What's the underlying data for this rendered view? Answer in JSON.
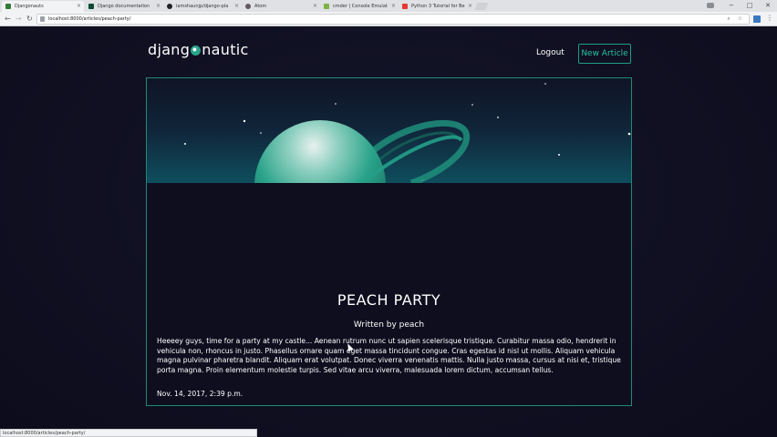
{
  "browser": {
    "tabs": [
      {
        "title": "Djangonauts",
        "favicon_color": "#2e7d32",
        "active": true
      },
      {
        "title": "Django documentation",
        "favicon_color": "#0c4b33",
        "active": false
      },
      {
        "title": "iamshaunjp/django-pla",
        "favicon_color": "#222222",
        "active": false
      },
      {
        "title": "Atom",
        "favicon_color": "#66595c",
        "active": false
      },
      {
        "title": "cmder | Console Emulat",
        "favicon_color": "#7cb342",
        "active": false
      },
      {
        "title": "Python 3 Tutorial for Be",
        "favicon_color": "#e53935",
        "active": false
      }
    ],
    "url": "localhost:8000/articles/peach-party/",
    "status_url": "localhost:8000/articles/peach-party/",
    "icons": {
      "back": "←",
      "forward": "→",
      "reload": "↻",
      "omnibox_right": "⌕ ☆",
      "menu": "⋮",
      "minimize": "−",
      "maximize": "□",
      "close": "✕",
      "tab_close": "×"
    }
  },
  "site": {
    "brand_left": "djang",
    "brand_right": "nautic",
    "logout": "Logout",
    "new_article": "New Article"
  },
  "article": {
    "title": "PEACH PARTY",
    "author": "Written by peach",
    "body": "Heeeey guys, time for a party at my castle... Aenean rutrum nunc ut sapien scelerisque tristique. Curabitur massa odio, hendrerit in vehicula non, rhoncus in justo. Phasellus ornare quam eget massa tincidunt congue. Cras egestas id nisl ut mollis. Aliquam vehicula magna pulvinar pharetra blandit. Aliquam erat volutpat. Donec viverra venenatis mattis. Nulla justo massa, cursus at nisi et, tristique porta magna. Proin elementum molestie turpis. Sed vitae arcu viverra, malesuada lorem dictum, accumsan tellus.",
    "date": "Nov. 14, 2017, 2:39 p.m."
  },
  "colors": {
    "accent": "#27c3a0",
    "border": "#1f8a74",
    "background": "#0f0f22",
    "planet": "#2aa38a"
  }
}
